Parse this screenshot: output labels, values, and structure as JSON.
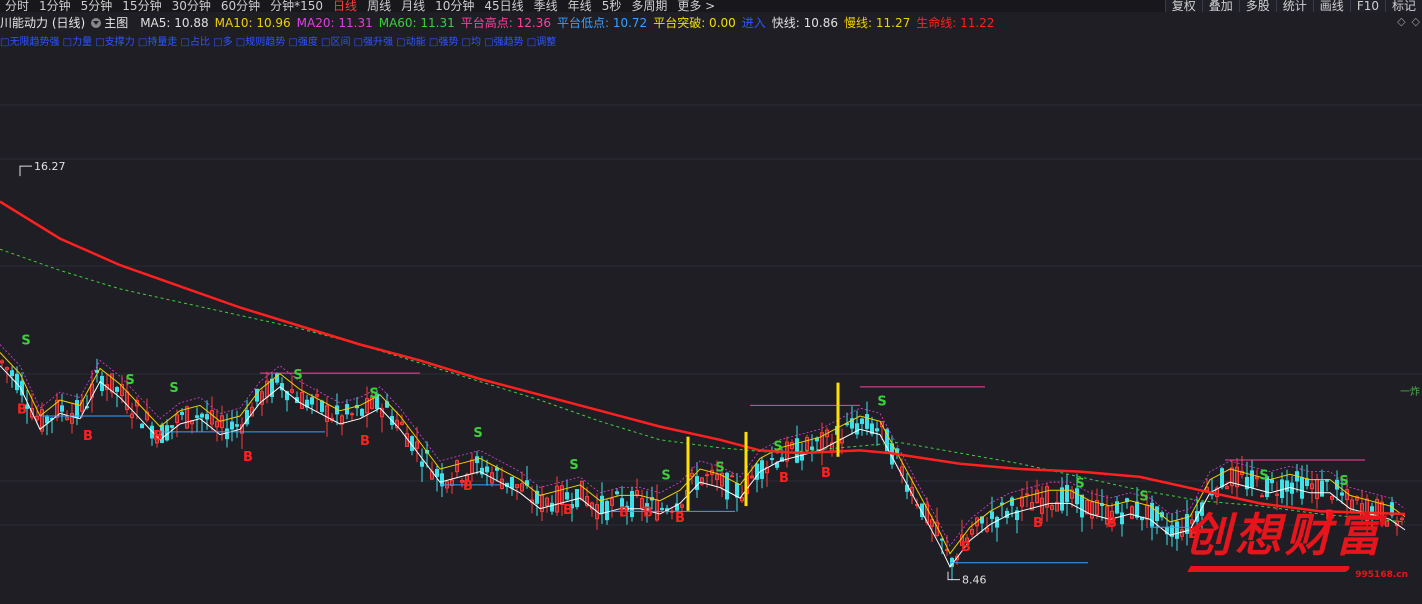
{
  "toolbar": {
    "periods": [
      {
        "label": "分时",
        "active": false
      },
      {
        "label": "1分钟",
        "active": false
      },
      {
        "label": "5分钟",
        "active": false
      },
      {
        "label": "15分钟",
        "active": false
      },
      {
        "label": "30分钟",
        "active": false
      },
      {
        "label": "60分钟",
        "active": false
      },
      {
        "label": "分钟*150",
        "active": false
      },
      {
        "label": "日线",
        "active": true
      },
      {
        "label": "周线",
        "active": false
      },
      {
        "label": "月线",
        "active": false
      },
      {
        "label": "10分钟",
        "active": false
      },
      {
        "label": "45日线",
        "active": false
      },
      {
        "label": "季线",
        "active": false
      },
      {
        "label": "年线",
        "active": false
      },
      {
        "label": "5秒",
        "active": false
      },
      {
        "label": "多周期",
        "active": false
      },
      {
        "label": "更多 >",
        "active": false
      }
    ],
    "tools": [
      "复权",
      "叠加",
      "多股",
      "统计",
      "画线",
      "F10",
      "标记"
    ]
  },
  "legend": {
    "stock_name": "川能动力 (日线)",
    "main_label": "主图",
    "items": [
      {
        "text": "MA5: 10.88",
        "color": "#e0e0e0"
      },
      {
        "text": "MA10: 10.96",
        "color": "#f0d000"
      },
      {
        "text": "MA20: 11.31",
        "color": "#e040e0"
      },
      {
        "text": "MA60: 11.31",
        "color": "#3cd03c"
      },
      {
        "text": "平台高点: 12.36",
        "color": "#ff40a0"
      },
      {
        "text": "平台低点: 10.72",
        "color": "#3aa0ff"
      },
      {
        "text": "平台突破: 0.00",
        "color": "#f0e000"
      },
      {
        "text": "进入",
        "color": "#2f55ff"
      },
      {
        "text": "快线: 10.86",
        "color": "#e0e0e0"
      },
      {
        "text": "慢线: 11.27",
        "color": "#f0d000"
      },
      {
        "text": "生命线: 11.22",
        "color": "#ff2020"
      }
    ]
  },
  "subline": "□无限趋势强 □力量 □支撑力 □持量走 □占比 □多 □规则趋势 □强度 □区间 □强升强 □动能 □强势 □均 □强趋势 □调整",
  "price_labels": {
    "high": "16.27",
    "low": "8.46"
  },
  "ytag": "一炸",
  "logo": {
    "text": "创想财富",
    "url": "995168.cn"
  },
  "colors": {
    "up": "#ff3b3b",
    "down": "#3ee0e8",
    "life_line": "#ff2020",
    "ma60": "#3cd03c",
    "fast": "#ffffff",
    "slow": "#f0d000",
    "ma20": "#e040e0",
    "platform_high": "#ff40a0",
    "platform_low": "#3aa0ff",
    "buy_signal": "#ff2020",
    "sell_signal": "#3cd03c"
  },
  "chart_data": {
    "type": "candlestick",
    "price_range": [
      8.0,
      18.5
    ],
    "extremes": {
      "high": 16.27,
      "low": 8.46
    },
    "life_line": [
      [
        0,
        15.6
      ],
      [
        60,
        14.9
      ],
      [
        120,
        14.4
      ],
      [
        180,
        14.0
      ],
      [
        240,
        13.6
      ],
      [
        300,
        13.25
      ],
      [
        360,
        12.9
      ],
      [
        420,
        12.6
      ],
      [
        480,
        12.25
      ],
      [
        540,
        11.95
      ],
      [
        600,
        11.65
      ],
      [
        660,
        11.35
      ],
      [
        720,
        11.1
      ],
      [
        760,
        10.9
      ],
      [
        800,
        10.85
      ],
      [
        860,
        10.9
      ],
      [
        890,
        10.85
      ],
      [
        960,
        10.65
      ],
      [
        1020,
        10.55
      ],
      [
        1080,
        10.5
      ],
      [
        1140,
        10.4
      ],
      [
        1200,
        10.15
      ],
      [
        1260,
        9.9
      ],
      [
        1320,
        9.75
      ],
      [
        1405,
        9.7
      ]
    ],
    "ma60": [
      [
        0,
        14.7
      ],
      [
        60,
        14.3
      ],
      [
        120,
        13.95
      ],
      [
        180,
        13.7
      ],
      [
        240,
        13.45
      ],
      [
        300,
        13.2
      ],
      [
        360,
        12.9
      ],
      [
        420,
        12.55
      ],
      [
        480,
        12.2
      ],
      [
        540,
        11.85
      ],
      [
        600,
        11.45
      ],
      [
        660,
        11.1
      ],
      [
        720,
        10.95
      ],
      [
        780,
        10.85
      ],
      [
        840,
        10.95
      ],
      [
        900,
        11.05
      ],
      [
        960,
        10.85
      ],
      [
        1020,
        10.65
      ],
      [
        1080,
        10.4
      ],
      [
        1140,
        10.15
      ],
      [
        1200,
        9.95
      ],
      [
        1260,
        9.85
      ],
      [
        1320,
        9.7
      ],
      [
        1405,
        9.55
      ]
    ],
    "price_path": [
      [
        0,
        12.6
      ],
      [
        20,
        12.2
      ],
      [
        40,
        11.4
      ],
      [
        60,
        11.7
      ],
      [
        80,
        11.6
      ],
      [
        100,
        12.3
      ],
      [
        120,
        12.0
      ],
      [
        140,
        11.6
      ],
      [
        160,
        11.2
      ],
      [
        180,
        11.5
      ],
      [
        200,
        11.6
      ],
      [
        220,
        11.3
      ],
      [
        240,
        11.4
      ],
      [
        260,
        11.9
      ],
      [
        280,
        12.2
      ],
      [
        300,
        11.9
      ],
      [
        320,
        11.7
      ],
      [
        340,
        11.5
      ],
      [
        360,
        11.6
      ],
      [
        380,
        11.8
      ],
      [
        400,
        11.4
      ],
      [
        420,
        10.9
      ],
      [
        440,
        10.4
      ],
      [
        460,
        10.5
      ],
      [
        480,
        10.6
      ],
      [
        500,
        10.4
      ],
      [
        520,
        10.2
      ],
      [
        540,
        9.9
      ],
      [
        560,
        10.0
      ],
      [
        580,
        10.1
      ],
      [
        600,
        9.8
      ],
      [
        620,
        9.9
      ],
      [
        640,
        9.9
      ],
      [
        660,
        9.8
      ],
      [
        680,
        10.0
      ],
      [
        700,
        10.4
      ],
      [
        720,
        10.3
      ],
      [
        740,
        10.1
      ],
      [
        760,
        10.6
      ],
      [
        780,
        10.8
      ],
      [
        800,
        10.9
      ],
      [
        820,
        11.0
      ],
      [
        840,
        11.2
      ],
      [
        860,
        11.4
      ],
      [
        880,
        11.3
      ],
      [
        900,
        10.6
      ],
      [
        920,
        9.9
      ],
      [
        940,
        9.2
      ],
      [
        950,
        8.8
      ],
      [
        970,
        9.3
      ],
      [
        990,
        9.6
      ],
      [
        1010,
        9.8
      ],
      [
        1030,
        9.9
      ],
      [
        1050,
        10.0
      ],
      [
        1070,
        10.0
      ],
      [
        1090,
        9.8
      ],
      [
        1110,
        9.7
      ],
      [
        1130,
        9.8
      ],
      [
        1150,
        9.7
      ],
      [
        1170,
        9.4
      ],
      [
        1190,
        9.5
      ],
      [
        1210,
        10.2
      ],
      [
        1230,
        10.4
      ],
      [
        1250,
        10.3
      ],
      [
        1270,
        10.2
      ],
      [
        1290,
        10.3
      ],
      [
        1310,
        10.2
      ],
      [
        1330,
        10.2
      ],
      [
        1350,
        9.9
      ],
      [
        1370,
        9.8
      ],
      [
        1390,
        9.7
      ],
      [
        1405,
        9.5
      ]
    ],
    "platform_high_segments": [
      [
        260,
        420,
        12.36
      ],
      [
        750,
        860,
        11.75
      ],
      [
        860,
        985,
        12.1
      ],
      [
        1225,
        1365,
        10.72
      ]
    ],
    "platform_low_segments": [
      [
        40,
        130,
        11.55
      ],
      [
        160,
        325,
        11.25
      ],
      [
        440,
        500,
        10.25
      ],
      [
        610,
        735,
        9.75
      ],
      [
        950,
        1088,
        8.78
      ],
      [
        1150,
        1190,
        9.45
      ]
    ],
    "breakout_bars": [
      688,
      746,
      838
    ],
    "buy_signals": [
      [
        22,
        11.6
      ],
      [
        88,
        11.1
      ],
      [
        158,
        11.1
      ],
      [
        248,
        10.7
      ],
      [
        365,
        11.0
      ],
      [
        468,
        10.15
      ],
      [
        568,
        9.7
      ],
      [
        624,
        9.65
      ],
      [
        648,
        9.65
      ],
      [
        680,
        9.55
      ],
      [
        784,
        10.3
      ],
      [
        826,
        10.4
      ],
      [
        966,
        9.0
      ],
      [
        1038,
        9.45
      ],
      [
        1112,
        9.45
      ],
      [
        1193,
        9.25
      ],
      [
        1330,
        9.6
      ]
    ],
    "sell_signals": [
      [
        26,
        12.9
      ],
      [
        130,
        12.15
      ],
      [
        174,
        12.0
      ],
      [
        298,
        12.25
      ],
      [
        374,
        11.9
      ],
      [
        478,
        11.15
      ],
      [
        574,
        10.55
      ],
      [
        666,
        10.35
      ],
      [
        720,
        10.5
      ],
      [
        778,
        10.9
      ],
      [
        882,
        11.75
      ],
      [
        1080,
        10.2
      ],
      [
        1144,
        9.95
      ],
      [
        1264,
        10.35
      ],
      [
        1344,
        10.25
      ]
    ]
  }
}
